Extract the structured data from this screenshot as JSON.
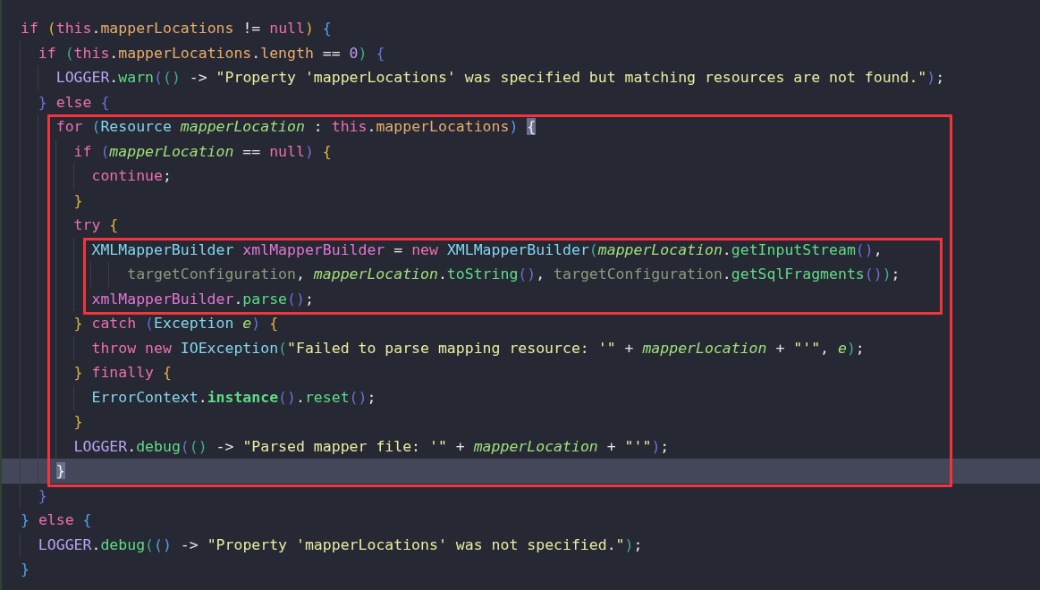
{
  "editor": {
    "lines": [
      {
        "kind": "line",
        "current": false,
        "tokens": [
          {
            "text": "if ",
            "kind": "keyword"
          },
          {
            "text": "(",
            "kind": "brace-y"
          },
          {
            "text": "this",
            "kind": "keyword"
          },
          {
            "text": ".",
            "kind": "plain"
          },
          {
            "text": "mapperLocations",
            "kind": "field"
          },
          {
            "text": " != ",
            "kind": "plain"
          },
          {
            "text": "null",
            "kind": "keyword"
          },
          {
            "text": ") ",
            "kind": "brace-y"
          },
          {
            "text": "{",
            "kind": "brace-u"
          }
        ],
        "children": [
          {
            "kind": "line",
            "current": false,
            "tokens": [
              {
                "text": "if ",
                "kind": "keyword"
              },
              {
                "text": "(",
                "kind": "brace-g"
              },
              {
                "text": "this",
                "kind": "keyword"
              },
              {
                "text": ".",
                "kind": "plain"
              },
              {
                "text": "mapperLocations",
                "kind": "field"
              },
              {
                "text": ".",
                "kind": "plain"
              },
              {
                "text": "length",
                "kind": "field"
              },
              {
                "text": " == ",
                "kind": "plain"
              },
              {
                "text": "0",
                "kind": "number"
              },
              {
                "text": ") ",
                "kind": "brace-g"
              },
              {
                "text": "{",
                "kind": "brace-b"
              }
            ],
            "children": [
              {
                "kind": "line",
                "current": false,
                "tokens": [
                  {
                    "text": "LOGGER",
                    "kind": "constant"
                  },
                  {
                    "text": ".",
                    "kind": "plain"
                  },
                  {
                    "text": "warn",
                    "kind": "method"
                  },
                  {
                    "text": "(",
                    "kind": "brace-b"
                  },
                  {
                    "text": "()",
                    "kind": "brace-g"
                  },
                  {
                    "text": " -> ",
                    "kind": "plain"
                  },
                  {
                    "text": "\"Property 'mapperLocations' was specified but matching resources are not found.\"",
                    "kind": "string"
                  },
                  {
                    "text": ")",
                    "kind": "brace-b"
                  },
                  {
                    "text": ";",
                    "kind": "plain"
                  }
                ]
              }
            ]
          },
          {
            "kind": "line",
            "current": false,
            "tokens": [
              {
                "text": "} ",
                "kind": "brace-b"
              },
              {
                "text": "else ",
                "kind": "keyword"
              },
              {
                "text": "{",
                "kind": "brace-b"
              }
            ],
            "children": [
              {
                "kind": "box",
                "lines": [
                  {
                    "kind": "line",
                    "current": false,
                    "tokens": [
                      {
                        "text": "for ",
                        "kind": "keyword"
                      },
                      {
                        "text": "(",
                        "kind": "brace-u"
                      },
                      {
                        "text": "Resource ",
                        "kind": "type"
                      },
                      {
                        "text": "mapperLocation",
                        "kind": "param"
                      },
                      {
                        "text": " : ",
                        "kind": "plain"
                      },
                      {
                        "text": "this",
                        "kind": "keyword"
                      },
                      {
                        "text": ".",
                        "kind": "plain"
                      },
                      {
                        "text": "mapperLocations",
                        "kind": "field"
                      },
                      {
                        "text": ") ",
                        "kind": "brace-u"
                      },
                      {
                        "text": "{",
                        "kind": "brace-match"
                      }
                    ],
                    "children": [
                      {
                        "kind": "line",
                        "current": false,
                        "tokens": [
                          {
                            "text": "if ",
                            "kind": "keyword"
                          },
                          {
                            "text": "(",
                            "kind": "brace-b"
                          },
                          {
                            "text": "mapperLocation",
                            "kind": "param"
                          },
                          {
                            "text": " == ",
                            "kind": "plain"
                          },
                          {
                            "text": "null",
                            "kind": "keyword"
                          },
                          {
                            "text": ") ",
                            "kind": "brace-b"
                          },
                          {
                            "text": "{",
                            "kind": "brace-y"
                          }
                        ],
                        "children": [
                          {
                            "kind": "line",
                            "current": false,
                            "tokens": [
                              {
                                "text": "continue",
                                "kind": "keyword"
                              },
                              {
                                "text": ";",
                                "kind": "plain"
                              }
                            ]
                          }
                        ]
                      },
                      {
                        "kind": "line",
                        "current": false,
                        "tokens": [
                          {
                            "text": "}",
                            "kind": "brace-y"
                          }
                        ]
                      },
                      {
                        "kind": "line",
                        "current": false,
                        "tokens": [
                          {
                            "text": "try ",
                            "kind": "keyword"
                          },
                          {
                            "text": "{",
                            "kind": "brace-y"
                          }
                        ],
                        "children": [
                          {
                            "kind": "box",
                            "lines": [
                              {
                                "kind": "line",
                                "current": false,
                                "tokens": [
                                  {
                                    "text": "XMLMapperBuilder ",
                                    "kind": "type"
                                  },
                                  {
                                    "text": "xmlMapperBuilder",
                                    "kind": "local"
                                  },
                                  {
                                    "text": " = ",
                                    "kind": "plain"
                                  },
                                  {
                                    "text": "new ",
                                    "kind": "keyword"
                                  },
                                  {
                                    "text": "XMLMapperBuilder",
                                    "kind": "type"
                                  },
                                  {
                                    "text": "(",
                                    "kind": "brace-g"
                                  },
                                  {
                                    "text": "mapperLocation",
                                    "kind": "param"
                                  },
                                  {
                                    "text": ".",
                                    "kind": "plain"
                                  },
                                  {
                                    "text": "getInputStream",
                                    "kind": "method"
                                  },
                                  {
                                    "text": "()",
                                    "kind": "brace-b"
                                  },
                                  {
                                    "text": ",",
                                    "kind": "plain"
                                  }
                                ],
                                "children": [
                                  {
                                    "kind": "continuation",
                                    "current": false,
                                    "tokens": [
                                      {
                                        "text": "targetConfiguration",
                                        "kind": "dim"
                                      },
                                      {
                                        "text": ", ",
                                        "kind": "plain"
                                      },
                                      {
                                        "text": "mapperLocation",
                                        "kind": "param"
                                      },
                                      {
                                        "text": ".",
                                        "kind": "plain"
                                      },
                                      {
                                        "text": "toString",
                                        "kind": "method"
                                      },
                                      {
                                        "text": "()",
                                        "kind": "brace-b"
                                      },
                                      {
                                        "text": ", ",
                                        "kind": "plain"
                                      },
                                      {
                                        "text": "targetConfiguration",
                                        "kind": "dim"
                                      },
                                      {
                                        "text": ".",
                                        "kind": "plain"
                                      },
                                      {
                                        "text": "getSqlFragments",
                                        "kind": "method"
                                      },
                                      {
                                        "text": "()",
                                        "kind": "brace-b"
                                      },
                                      {
                                        "text": ")",
                                        "kind": "brace-g"
                                      },
                                      {
                                        "text": ";",
                                        "kind": "plain"
                                      }
                                    ]
                                  }
                                ]
                              },
                              {
                                "kind": "line",
                                "current": false,
                                "tokens": [
                                  {
                                    "text": "xmlMapperBuilder",
                                    "kind": "local"
                                  },
                                  {
                                    "text": ".",
                                    "kind": "plain"
                                  },
                                  {
                                    "text": "parse",
                                    "kind": "method"
                                  },
                                  {
                                    "text": "()",
                                    "kind": "brace-b"
                                  },
                                  {
                                    "text": ";",
                                    "kind": "plain"
                                  }
                                ]
                              }
                            ]
                          }
                        ]
                      },
                      {
                        "kind": "line",
                        "current": false,
                        "tokens": [
                          {
                            "text": "} ",
                            "kind": "brace-y"
                          },
                          {
                            "text": "catch ",
                            "kind": "keyword"
                          },
                          {
                            "text": "(",
                            "kind": "brace-b"
                          },
                          {
                            "text": "Exception ",
                            "kind": "type"
                          },
                          {
                            "text": "e",
                            "kind": "param"
                          },
                          {
                            "text": ") ",
                            "kind": "brace-b"
                          },
                          {
                            "text": "{",
                            "kind": "brace-y"
                          }
                        ],
                        "children": [
                          {
                            "kind": "line",
                            "current": false,
                            "tokens": [
                              {
                                "text": "throw new ",
                                "kind": "keyword"
                              },
                              {
                                "text": "IOException",
                                "kind": "type"
                              },
                              {
                                "text": "(",
                                "kind": "brace-g"
                              },
                              {
                                "text": "\"Failed to parse mapping resource: '\"",
                                "kind": "string"
                              },
                              {
                                "text": " + ",
                                "kind": "plain"
                              },
                              {
                                "text": "mapperLocation",
                                "kind": "param"
                              },
                              {
                                "text": " + ",
                                "kind": "plain"
                              },
                              {
                                "text": "\"'\"",
                                "kind": "string"
                              },
                              {
                                "text": ", ",
                                "kind": "plain"
                              },
                              {
                                "text": "e",
                                "kind": "param"
                              },
                              {
                                "text": ")",
                                "kind": "brace-g"
                              },
                              {
                                "text": ";",
                                "kind": "plain"
                              }
                            ]
                          }
                        ]
                      },
                      {
                        "kind": "line",
                        "current": false,
                        "tokens": [
                          {
                            "text": "} ",
                            "kind": "brace-y"
                          },
                          {
                            "text": "finally ",
                            "kind": "keyword"
                          },
                          {
                            "text": "{",
                            "kind": "brace-y"
                          }
                        ],
                        "children": [
                          {
                            "kind": "line",
                            "current": false,
                            "tokens": [
                              {
                                "text": "ErrorContext",
                                "kind": "type"
                              },
                              {
                                "text": ".",
                                "kind": "plain"
                              },
                              {
                                "text": "instance",
                                "kind": "method-bold"
                              },
                              {
                                "text": "()",
                                "kind": "brace-b"
                              },
                              {
                                "text": ".",
                                "kind": "plain"
                              },
                              {
                                "text": "reset",
                                "kind": "method"
                              },
                              {
                                "text": "()",
                                "kind": "brace-b"
                              },
                              {
                                "text": ";",
                                "kind": "plain"
                              }
                            ]
                          }
                        ]
                      },
                      {
                        "kind": "line",
                        "current": false,
                        "tokens": [
                          {
                            "text": "}",
                            "kind": "brace-y"
                          }
                        ]
                      },
                      {
                        "kind": "line",
                        "current": false,
                        "tokens": [
                          {
                            "text": "LOGGER",
                            "kind": "constant"
                          },
                          {
                            "text": ".",
                            "kind": "plain"
                          },
                          {
                            "text": "debug",
                            "kind": "method"
                          },
                          {
                            "text": "(",
                            "kind": "brace-b"
                          },
                          {
                            "text": "()",
                            "kind": "brace-g"
                          },
                          {
                            "text": " -> ",
                            "kind": "plain"
                          },
                          {
                            "text": "\"Parsed mapper file: '\"",
                            "kind": "string"
                          },
                          {
                            "text": " + ",
                            "kind": "plain"
                          },
                          {
                            "text": "mapperLocation",
                            "kind": "param"
                          },
                          {
                            "text": " + ",
                            "kind": "plain"
                          },
                          {
                            "text": "\"'\"",
                            "kind": "string"
                          },
                          {
                            "text": ")",
                            "kind": "brace-b"
                          },
                          {
                            "text": ";",
                            "kind": "plain"
                          }
                        ]
                      }
                    ]
                  },
                  {
                    "kind": "line",
                    "current": true,
                    "tokens": [
                      {
                        "text": "}",
                        "kind": "brace-match"
                      }
                    ]
                  }
                ]
              }
            ]
          },
          {
            "kind": "line",
            "current": false,
            "tokens": [
              {
                "text": "}",
                "kind": "brace-b"
              }
            ]
          }
        ]
      },
      {
        "kind": "line",
        "current": false,
        "tokens": [
          {
            "text": "} ",
            "kind": "brace-u"
          },
          {
            "text": "else ",
            "kind": "keyword"
          },
          {
            "text": "{",
            "kind": "brace-u"
          }
        ],
        "children": [
          {
            "kind": "line",
            "current": false,
            "tokens": [
              {
                "text": "LOGGER",
                "kind": "constant"
              },
              {
                "text": ".",
                "kind": "plain"
              },
              {
                "text": "debug",
                "kind": "method"
              },
              {
                "text": "(",
                "kind": "brace-g"
              },
              {
                "text": "()",
                "kind": "brace-u"
              },
              {
                "text": " -> ",
                "kind": "plain"
              },
              {
                "text": "\"Property 'mapperLocations' was not specified.\"",
                "kind": "string"
              },
              {
                "text": ")",
                "kind": "brace-g"
              },
              {
                "text": ";",
                "kind": "plain"
              }
            ]
          }
        ]
      },
      {
        "kind": "line",
        "current": false,
        "tokens": [
          {
            "text": "}",
            "kind": "brace-u"
          }
        ]
      }
    ]
  }
}
